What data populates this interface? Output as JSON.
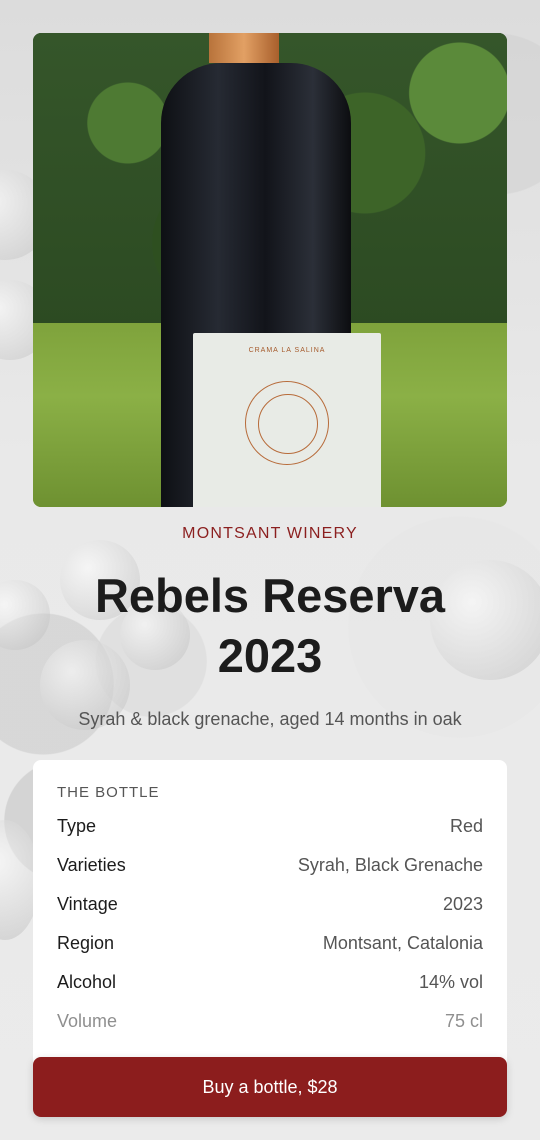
{
  "hero": {
    "image": "wine-bottle-on-grass-photo",
    "label_brand": "CRAMA LA SALINA"
  },
  "winery": "MONTSANT WINERY",
  "title_line1": "Rebels Reserva",
  "title_line2": "2023",
  "subtitle": "Syrah & black grenache, aged 14 months in oak",
  "bottle_card": {
    "heading": "THE BOTTLE",
    "rows": [
      {
        "key": "Type",
        "value": "Red"
      },
      {
        "key": "Varieties",
        "value": "Syrah, Black Grenache"
      },
      {
        "key": "Vintage",
        "value": "2023"
      },
      {
        "key": "Region",
        "value": "Montsant, Catalonia"
      },
      {
        "key": "Alcohol",
        "value": "14% vol"
      },
      {
        "key": "Volume",
        "value": "75 cl"
      }
    ]
  },
  "buy_button": {
    "label": "Buy a bottle, $28"
  },
  "colors": {
    "accent": "#8c1d1d",
    "winery_text": "#8b1f1f",
    "card_bg": "#ffffff"
  }
}
